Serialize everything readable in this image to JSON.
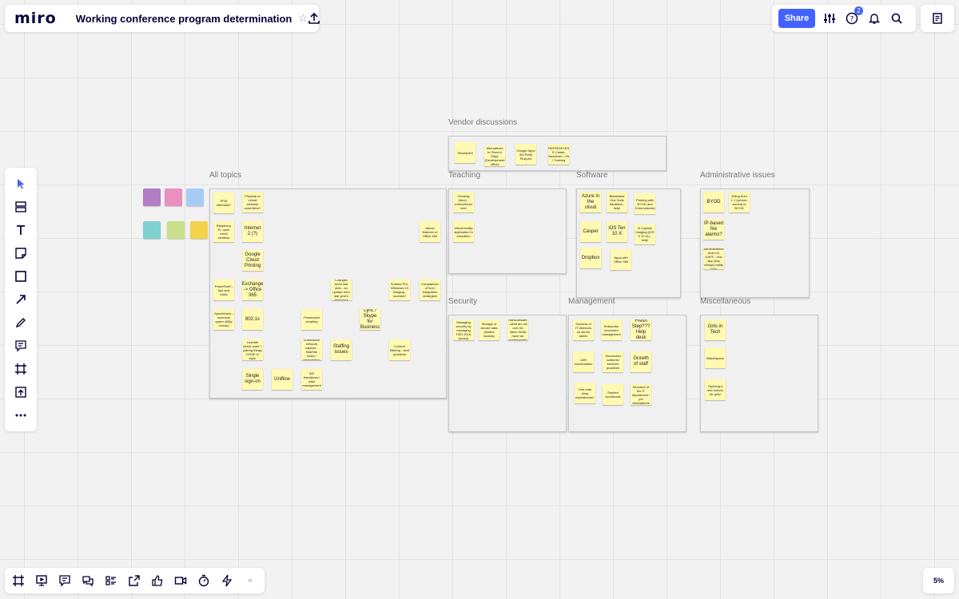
{
  "topbar": {
    "logo": "miro",
    "board_title": "Working conference program determination",
    "star_icon": "star-icon",
    "upload_icon": "upload-icon"
  },
  "header_right": {
    "share_label": "Share",
    "notification_count": "2",
    "icons": [
      "settings-sliders-icon",
      "help-icon",
      "bell-icon",
      "search-icon"
    ]
  },
  "left_tools": [
    "cursor-icon",
    "templates-icon",
    "text-icon",
    "sticky-note-icon",
    "shape-icon",
    "arrow-icon",
    "pen-icon",
    "comment-icon",
    "frame-icon",
    "upload-icon",
    "more-icon"
  ],
  "bottom_tools": [
    "frames-icon",
    "presentation-icon",
    "comments-icon",
    "chat-icon",
    "card-icon",
    "screen-share-icon",
    "like-icon",
    "video-icon",
    "timer-icon",
    "lightning-icon",
    "collapse-icon"
  ],
  "zoom": "5%",
  "colors": {
    "accent": "#4262ff",
    "sticky": "#fff9b1",
    "palette": [
      "#b17ec4",
      "#e990c0",
      "#a6ccf5",
      "#7fd1cf",
      "#c9df8a",
      "#f2d34b"
    ]
  },
  "frames": {
    "vendor": "Vendor discussions",
    "all": "All topics",
    "teaching": "Teaching",
    "software": "Software",
    "admin": "Administrative issues",
    "security": "Security",
    "management": "Management",
    "misc": "Miscellaneous"
  },
  "stickies": {
    "vendor": [
      "Sharepoint",
      "Alternatives to Pacer's Edge (Development office)",
      "Google Apps 3rd Party Plug-ins",
      "PRINTNGEXES? E-Caster Showdown - HW / Training"
    ],
    "all": [
      "IPV6 internally?",
      "Physical or virtual wireless controllers?",
      "Raspberry Pi, open mesh wireless",
      "Internet 2 (?)",
      "Admin features of Office 365",
      "Google Cloud Printing",
      "PowerShell - tips and tricks",
      "Exchange -> Office 365",
      "Changes since last year - an update from last year's attendees",
      "Surface Pro, Windows 10 Imaging - courses?",
      "Comparison of tech integration strategies",
      "SpiceWorks - inventory queen (Billy Ocean)",
      "802.1x",
      "Powershell scripting",
      "Lync / Skype for Business",
      "Live/site check mark + pairing things DONE in style",
      "Summarize network capture - MailSite tricks / remediation",
      "Staffing issues",
      "Content filtering - best practices",
      "Single sign-on",
      "Uniflow",
      "SIS transitions / data management"
    ],
    "teaching": [
      "Growing (time) - instructional tech",
      "Virtual reality application in education"
    ],
    "software": [
      "Azure in the cloud",
      "Blackbaud One Suite transition - help!",
      "Printing with BYOD and Chromebooks",
      "Casper",
      "iOS Ten 10 X",
      "iX Caption Imaging (iOS X 10.11) - help!",
      "Dropbox",
      "Apps with Office 365"
    ],
    "admin": [
      "BYOD",
      "Going from 1-1 (school-owned) to BYOD",
      "IP-based fire alarms?",
      "Administrative tools for GAFE - Vbo app (tiny cheap) reality tools"
    ],
    "security": [
      "Managing security by managing FBO 2016 (scary)",
      "Storage of secure data (limited access)",
      "Ransomware - what are we over for data? What have we implemented"
    ],
    "management": [
      "Success of IT directors on senior admin",
      "Enterprise document management",
      "Fresh Step??? Help desk",
      "LMS conversation",
      "Successful customer services practices",
      "Growth of staff",
      "One-man shop experiences?",
      "Student workforces",
      "Structure of the IT department / job descriptions"
    ],
    "misc": [
      "Girls in Tech",
      "Makerspace",
      "Opening a new school, for girls!"
    ]
  }
}
